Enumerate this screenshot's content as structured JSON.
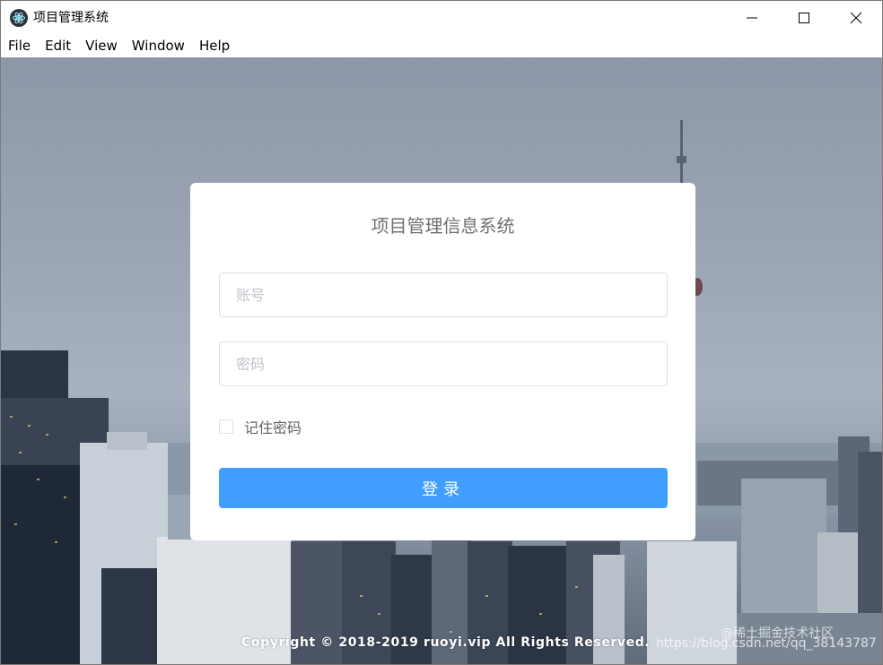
{
  "window": {
    "title": "项目管理系统",
    "icon": "electron-atom-icon"
  },
  "menu": {
    "items": [
      "File",
      "Edit",
      "View",
      "Window",
      "Help"
    ]
  },
  "login": {
    "title": "项目管理信息系统",
    "username_placeholder": "账号",
    "username_value": "",
    "password_placeholder": "密码",
    "password_value": "",
    "remember_label": "记住密码",
    "remember_checked": false,
    "submit_label": "登录"
  },
  "footer": {
    "copyright": "Copyright © 2018-2019 ruoyi.vip All Rights Reserved.",
    "watermark_line1": "@稀土掘金技术社区",
    "watermark_line2": "https://blog.csdn.net/qq_38143787"
  },
  "colors": {
    "primary": "#409eff",
    "card_background": "#ffffff",
    "title_text": "#707070"
  }
}
